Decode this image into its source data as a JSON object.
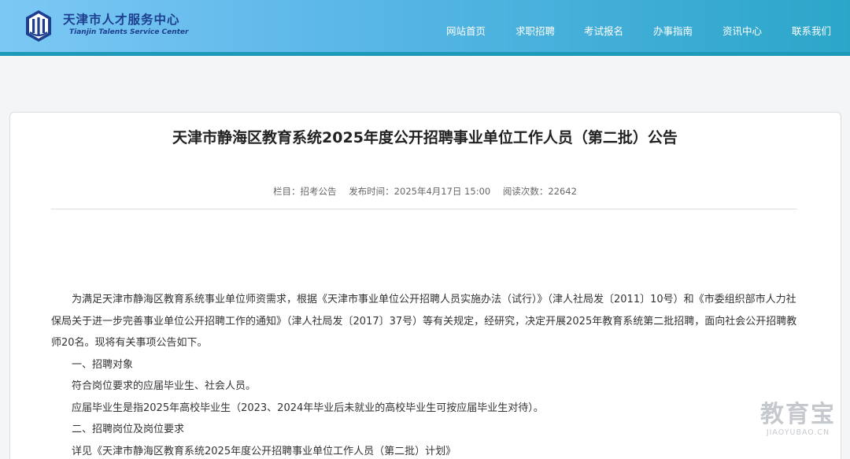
{
  "header": {
    "brand_cn": "天津市人才服务中心",
    "brand_en": "Tianjin Talents Service Center",
    "logo_icon": "tianjin-talents-logo-icon",
    "nav": [
      "网站首页",
      "求职招聘",
      "考试报名",
      "办事指南",
      "资讯中心",
      "联系我们"
    ]
  },
  "article": {
    "title": "天津市静海区教育系统2025年度公开招聘事业单位工作人员（第二批）公告",
    "meta": {
      "category": "栏目：招考公告",
      "published": "发布时间：2025年4月17日 15:00",
      "views": "阅读次数：22642"
    },
    "paragraphs": [
      "为满足天津市静海区教育系统事业单位师资需求，根据《天津市事业单位公开招聘人员实施办法（试行）》（津人社局发〔2011〕10号）和《市委组织部市人力社保局关于进一步完善事业单位公开招聘工作的通知》（津人社局发〔2017〕37号）等有关规定，经研究，决定开展2025年教育系统第二批招聘，面向社会公开招聘教师20名。现将有关事项公告如下。",
      "一、招聘对象",
      "符合岗位要求的应届毕业生、社会人员。",
      "应届毕业生是指2025年高校毕业生（2023、2024年毕业后未就业的高校毕业生可按应届毕业生对待）。",
      "二、招聘岗位及岗位要求",
      "详见《天津市静海区教育系统2025年度公开招聘事业单位工作人员（第二批）计划》"
    ]
  },
  "watermark": {
    "cn": "教育宝",
    "en": "JIAOYUBAO.CN"
  }
}
